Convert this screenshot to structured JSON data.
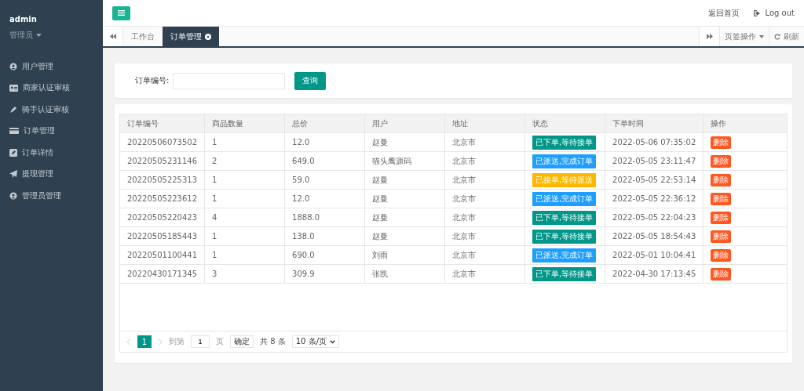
{
  "sidebar": {
    "user": "admin",
    "role": "管理员",
    "items": [
      {
        "label": "用户管理"
      },
      {
        "label": "商家认证审核"
      },
      {
        "label": "骑手认证审核"
      },
      {
        "label": "订单管理"
      },
      {
        "label": "订单详情"
      },
      {
        "label": "提现管理"
      },
      {
        "label": "管理员管理"
      }
    ]
  },
  "header": {
    "links": [
      "返回首页",
      "Log out"
    ]
  },
  "tabs": [
    {
      "label": "工作台",
      "selected": false,
      "closable": false
    },
    {
      "label": "订单管理",
      "selected": true,
      "closable": true
    }
  ],
  "tab_actions": {
    "menu": "页签操作",
    "refresh": "刷新"
  },
  "search": {
    "label": "订单编号:",
    "button": "查询"
  },
  "table": {
    "columns": [
      "订单编号",
      "商品数量",
      "总价",
      "用户",
      "地址",
      "状态",
      "下单时间",
      "操作"
    ],
    "rows": [
      {
        "id": "20220506073502",
        "qty": "1",
        "total": "12.0",
        "user": "赵曼",
        "address": "北京市",
        "status": {
          "text": "已下单,等待接单",
          "kind": "ordered"
        },
        "time": "2022-05-06 07:35:02",
        "action": "删除"
      },
      {
        "id": "20220505231146",
        "qty": "2",
        "total": "649.0",
        "user": "猫头鹰源码",
        "address": "北京市",
        "status": {
          "text": "已派送,完成订单",
          "kind": "delivered"
        },
        "time": "2022-05-05 23:11:47",
        "action": "删除"
      },
      {
        "id": "20220505225313",
        "qty": "1",
        "total": "59.0",
        "user": "赵曼",
        "address": "北京市",
        "status": {
          "text": "已接单,等待派送",
          "kind": "accepted"
        },
        "time": "2022-05-05 22:53:14",
        "action": "删除"
      },
      {
        "id": "20220505223612",
        "qty": "1",
        "total": "12.0",
        "user": "赵曼",
        "address": "北京市",
        "status": {
          "text": "已派送,完成订单",
          "kind": "delivered"
        },
        "time": "2022-05-05 22:36:12",
        "action": "删除"
      },
      {
        "id": "20220505220423",
        "qty": "4",
        "total": "1888.0",
        "user": "赵曼",
        "address": "北京市",
        "status": {
          "text": "已下单,等待接单",
          "kind": "ordered"
        },
        "time": "2022-05-05 22:04:23",
        "action": "删除"
      },
      {
        "id": "20220505185443",
        "qty": "1",
        "total": "138.0",
        "user": "赵曼",
        "address": "北京市",
        "status": {
          "text": "已下单,等待接单",
          "kind": "ordered"
        },
        "time": "2022-05-05 18:54:43",
        "action": "删除"
      },
      {
        "id": "20220501100441",
        "qty": "1",
        "total": "690.0",
        "user": "刘雨",
        "address": "北京市",
        "status": {
          "text": "已派送,完成订单",
          "kind": "delivered"
        },
        "time": "2022-05-01 10:04:41",
        "action": "删除"
      },
      {
        "id": "20220430171345",
        "qty": "3",
        "total": "309.9",
        "user": "张凯",
        "address": "北京市",
        "status": {
          "text": "已下单,等待接单",
          "kind": "ordered"
        },
        "time": "2022-04-30 17:13:45",
        "action": "删除"
      }
    ]
  },
  "pagination": {
    "pages": [
      {
        "label": "1",
        "selected": true
      }
    ],
    "goto_label": "到第",
    "goto_value": "1",
    "page_unit": "页",
    "confirm": "确定",
    "total": "共 8 条",
    "page_size": "10 条/页"
  }
}
